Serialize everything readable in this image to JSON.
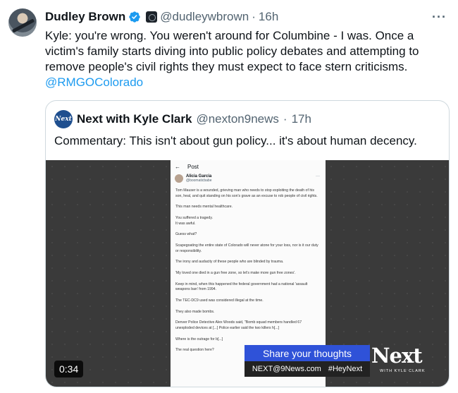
{
  "tweet": {
    "author_name": "Dudley Brown",
    "handle": "@dudleywbrown",
    "separator": "·",
    "time": "16h",
    "more_label": "···",
    "text": "Kyle: you're wrong.  You weren't around for Columbine - I was.  Once a victim's family starts diving into public policy debates and attempting to remove people's civil rights they must expect to face stern criticisms.",
    "mention": "@RMGOColorado",
    "icons": {
      "verified": "verified-badge-icon",
      "affiliate": "affiliate-badge-icon",
      "more": "more-icon"
    },
    "colors": {
      "accent": "#1d9bf0",
      "text": "#0f1419",
      "secondary": "#536471"
    }
  },
  "quote": {
    "author_name": "Next with Kyle Clark",
    "avatar_text": "Next",
    "handle": "@nexton9news",
    "separator": "·",
    "time": "17h",
    "text": "Commentary: This isn't about gun policy... it's about human decency."
  },
  "video": {
    "duration": "0:34",
    "overlay_share": "Share your thoughts",
    "overlay_email": "NEXT@9News.com",
    "overlay_hashtag": "#HeyNext",
    "logo_text": "Next",
    "logo_subtext": "WITH KYLE CLARK",
    "embedded_post": {
      "back": "←",
      "title": "Post",
      "user_name": "Alicia Garcia",
      "user_handle": "@boomaticbabe",
      "more": "···",
      "paragraphs": [
        "Tom Mauser is a wounded, grieving man who needs to stop exploiting the death of his son, heal, and quit standing on his son's grave as an excuse to rob people of civil rights.",
        "This man needs mental healthcare.",
        "You suffered a tragedy.\nIt was awful.",
        "Guess what?",
        "Scapegoating the entire state of Colorado will never atone for your loss, nor is it our duty or responsibility.",
        "The irony and audacity of these people who are blinded by trauma.",
        "'My loved one died in a gun free zone, so let's make more gun free zones'.",
        "Keep in mind, when this happened the federal government had a national 'assault weapons ban' from 1994.",
        "The TEC-DC9 used was considered illegal at the time.",
        "They also made bombs.",
        "Denver Police Detective Alex Woods said, \"Bomb squad members handled 67 unexploded devices at [...] Police earlier said the two killers h[...]",
        "Where is the outrage for b[...]",
        "The real question here?"
      ]
    }
  }
}
